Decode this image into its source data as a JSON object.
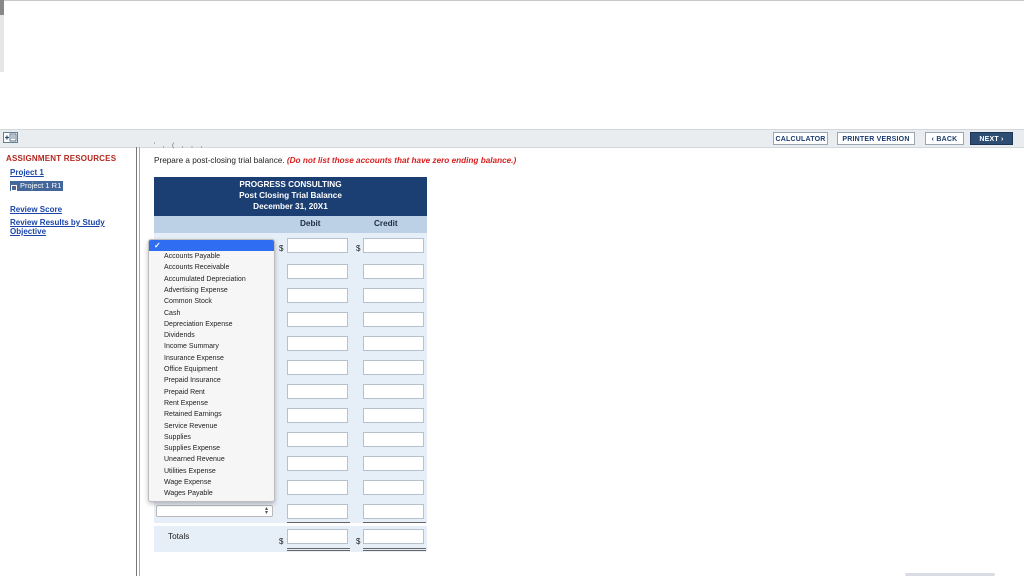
{
  "toolbar": {
    "calculator": "CALCULATOR",
    "printer_version": "PRINTER VERSION",
    "back": "BACK",
    "next": "NEXT"
  },
  "resources": {
    "title": "ASSIGNMENT RESOURCES",
    "project": "Project 1",
    "project_active": "Project 1 R1",
    "review_score": "Review Score",
    "review_results_line1": "Review Results by Study",
    "review_results_line2": "Objective"
  },
  "question": {
    "cutoff": "' , ( , , ,",
    "instruction": "Prepare a post-closing trial balance.",
    "instruction_note": "(Do not list those accounts that have zero ending balance.)"
  },
  "table": {
    "company": "PROGRESS CONSULTING",
    "title": "Post Closing Trial Balance",
    "date": "December 31, 20X1",
    "debit_header": "Debit",
    "credit_header": "Credit",
    "currency": "$",
    "totals_label": "Totals"
  },
  "dropdown": {
    "selected": "✓",
    "options": [
      "Accounts Payable",
      "Accounts Receivable",
      "Accumulated Depreciation",
      "Advertising Expense",
      "Common Stock",
      "Cash",
      "Depreciation Expense",
      "Dividends",
      "Income Summary",
      "Insurance Expense",
      "Office Equipment",
      "Prepaid Insurance",
      "Prepaid Rent",
      "Rent Expense",
      "Retained Earnings",
      "Service Revenue",
      "Supplies",
      "Supplies Expense",
      "Unearned Revenue",
      "Utilities Expense",
      "Wage Expense",
      "Wages Payable"
    ]
  },
  "icons": {
    "expand": "expand-panel-icon",
    "back_arrow": "chevron-left-icon",
    "next_arrow": "chevron-right-icon",
    "select_arrows": "select-arrows-icon"
  },
  "colors": {
    "header_navy": "#1b3e73",
    "column_header": "#bcd0e6",
    "row_background": "#e6eef7",
    "note_red": "#d81e1e",
    "dropdown_highlight": "#2f6df3"
  }
}
